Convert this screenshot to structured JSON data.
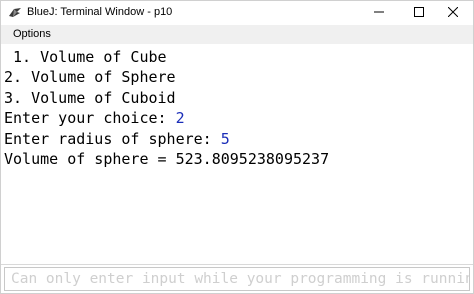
{
  "window": {
    "title": "BlueJ: Terminal Window - p10",
    "icon": "bluej-bird-icon"
  },
  "controls": {
    "minimize_icon": "minimize-icon",
    "maximize_icon": "maximize-icon",
    "close_icon": "close-icon"
  },
  "menubar": {
    "items": [
      {
        "label": "Options"
      }
    ]
  },
  "terminal": {
    "lines": [
      {
        "text": " 1. Volume of Cube",
        "input": ""
      },
      {
        "text": "2. Volume of Sphere",
        "input": ""
      },
      {
        "text": "3. Volume of Cuboid",
        "input": ""
      },
      {
        "text": "Enter your choice: ",
        "input": "2"
      },
      {
        "text": "Enter radius of sphere: ",
        "input": "5"
      },
      {
        "text": "Volume of sphere = 523.8095238095237",
        "input": ""
      }
    ],
    "input_color": "#1a2db8"
  },
  "input_bar": {
    "value": "",
    "placeholder": "Can only enter input while your programming is running"
  }
}
